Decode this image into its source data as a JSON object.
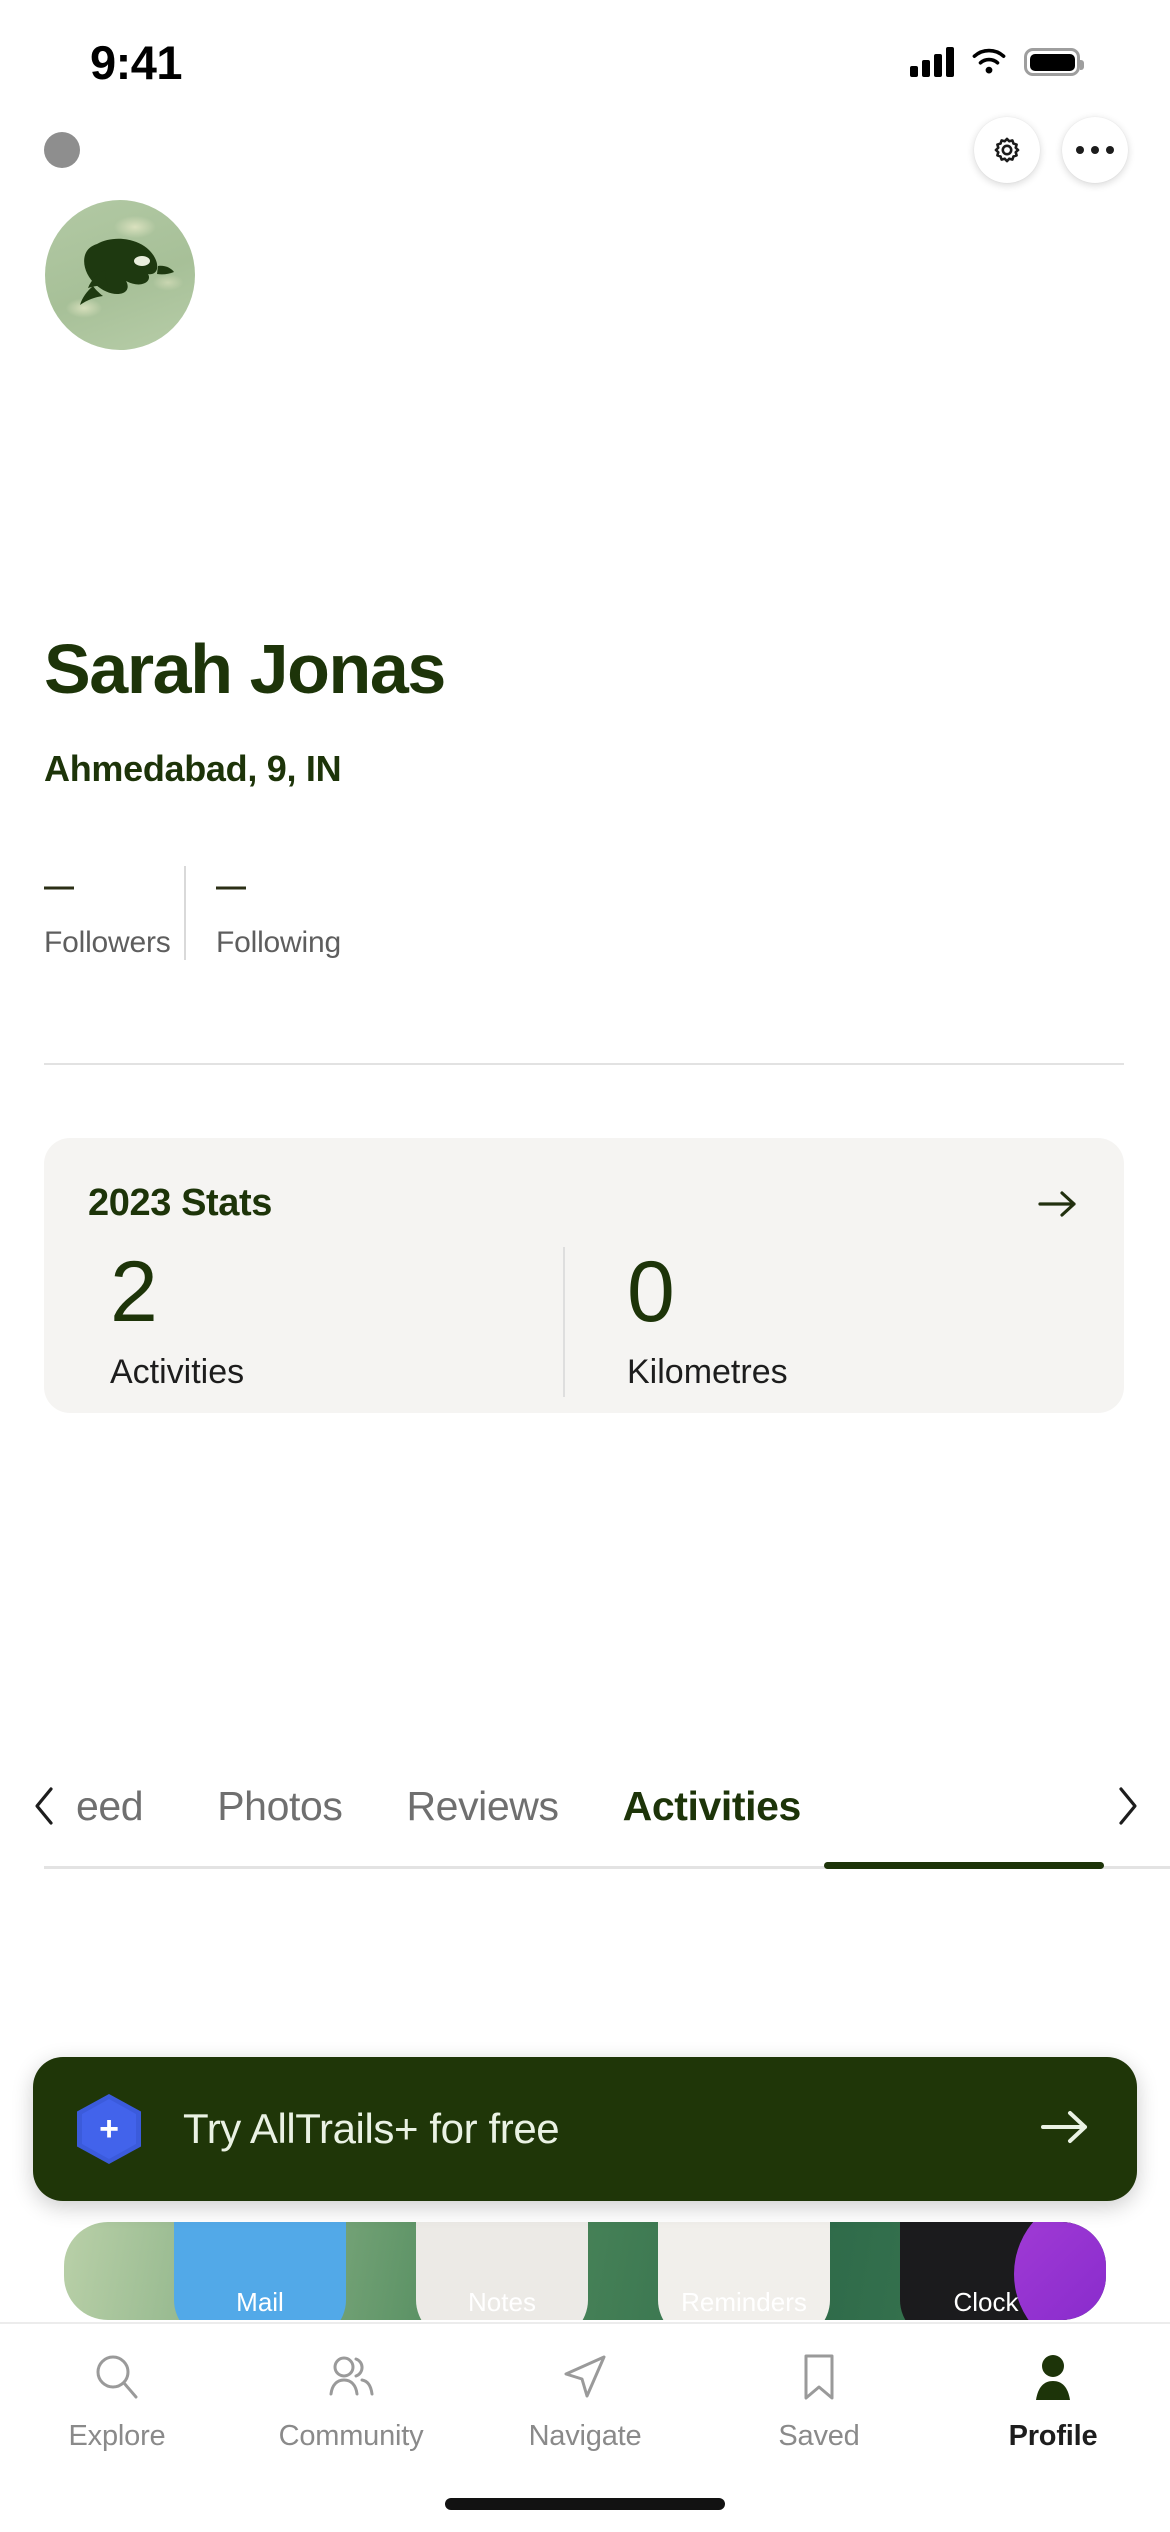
{
  "status_bar": {
    "time": "9:41",
    "signal_icon": "cellular-signal-icon",
    "wifi_icon": "wifi-icon",
    "battery_icon": "battery-icon"
  },
  "topbar": {
    "back_icon": "back-dot-icon",
    "settings_icon": "gear-icon",
    "more_icon": "more-options-icon"
  },
  "profile": {
    "avatar_icon": "eagle-avatar-icon",
    "name": "Sarah Jonas",
    "location": "Ahmedabad, 9, IN",
    "followers_value": "—",
    "followers_label": "Followers",
    "following_value": "—",
    "following_label": "Following"
  },
  "stats_card": {
    "title": "2023 Stats",
    "arrow_icon": "arrow-right-icon",
    "items": [
      {
        "value": "2",
        "label": "Activities"
      },
      {
        "value": "0",
        "label": "Kilometres"
      }
    ]
  },
  "tabs": {
    "prev_icon": "chevron-left-icon",
    "next_icon": "chevron-right-icon",
    "items": [
      {
        "label": "eed",
        "active": false
      },
      {
        "label": "Photos",
        "active": false
      },
      {
        "label": "Reviews",
        "active": false
      },
      {
        "label": "Activities",
        "active": true
      }
    ]
  },
  "promo": {
    "badge_icon": "alltrails-plus-hexagon-icon",
    "badge_glyph": "+",
    "text": "Try AllTrails+ for free",
    "arrow_icon": "arrow-right-icon"
  },
  "homescreen_peek": {
    "apps": [
      {
        "label": "Mail"
      },
      {
        "label": "Notes"
      },
      {
        "label": "Reminders"
      },
      {
        "label": "Clock"
      }
    ]
  },
  "bottom_nav": {
    "items": [
      {
        "label": "Explore",
        "icon": "search-icon",
        "active": false
      },
      {
        "label": "Community",
        "icon": "people-icon",
        "active": false
      },
      {
        "label": "Navigate",
        "icon": "navigation-arrow-icon",
        "active": false
      },
      {
        "label": "Saved",
        "icon": "bookmark-icon",
        "active": false
      },
      {
        "label": "Profile",
        "icon": "person-icon",
        "active": true
      }
    ]
  },
  "colors": {
    "brand_dark_green": "#1d3409",
    "card_bg": "#f5f4f2",
    "muted_text": "#6f6f6f",
    "plus_blue": "#4263eb"
  }
}
